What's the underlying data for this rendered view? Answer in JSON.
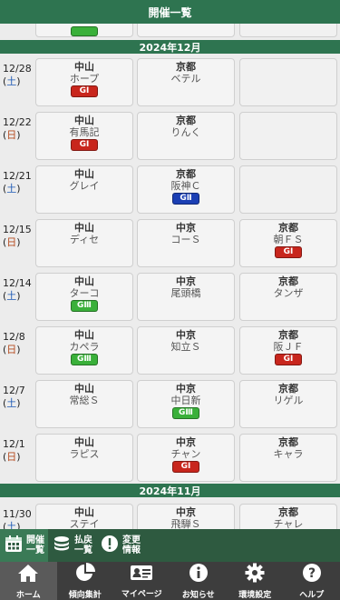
{
  "header": {
    "title": "開催一覧"
  },
  "colors": {
    "green_dark": "#2e7450",
    "g1": "#c8261d",
    "g2": "#1b3fb4",
    "g3": "#3ab03a"
  },
  "months": [
    {
      "label": "2024年12月"
    },
    {
      "label": "2024年11月"
    }
  ],
  "rows": [
    {
      "date": "12/28",
      "weekday": "土",
      "cells": [
        {
          "venue": "中山",
          "race": "ホープ",
          "grade": "GⅠ"
        },
        {
          "venue": "京都",
          "race": "ベテル",
          "grade": ""
        },
        null
      ]
    },
    {
      "date": "12/22",
      "weekday": "日",
      "cells": [
        {
          "venue": "中山",
          "race": "有馬記",
          "grade": "GⅠ"
        },
        {
          "venue": "京都",
          "race": "りんく",
          "grade": ""
        },
        null
      ]
    },
    {
      "date": "12/21",
      "weekday": "土",
      "cells": [
        {
          "venue": "中山",
          "race": "グレイ",
          "grade": ""
        },
        {
          "venue": "京都",
          "race": "阪神Ｃ",
          "grade": "GⅡ"
        },
        null
      ]
    },
    {
      "date": "12/15",
      "weekday": "日",
      "cells": [
        {
          "venue": "中山",
          "race": "ディセ",
          "grade": ""
        },
        {
          "venue": "中京",
          "race": "コーＳ",
          "grade": ""
        },
        {
          "venue": "京都",
          "race": "朝ＦＳ",
          "grade": "GⅠ"
        }
      ]
    },
    {
      "date": "12/14",
      "weekday": "土",
      "cells": [
        {
          "venue": "中山",
          "race": "ターコ",
          "grade": "GⅢ"
        },
        {
          "venue": "中京",
          "race": "尾頭橋",
          "grade": ""
        },
        {
          "venue": "京都",
          "race": "タンザ",
          "grade": ""
        }
      ]
    },
    {
      "date": "12/8",
      "weekday": "日",
      "cells": [
        {
          "venue": "中山",
          "race": "カペラ",
          "grade": "GⅢ"
        },
        {
          "venue": "中京",
          "race": "知立Ｓ",
          "grade": ""
        },
        {
          "venue": "京都",
          "race": "阪ＪＦ",
          "grade": "GⅠ"
        }
      ]
    },
    {
      "date": "12/7",
      "weekday": "土",
      "cells": [
        {
          "venue": "中山",
          "race": "常総Ｓ",
          "grade": ""
        },
        {
          "venue": "中京",
          "race": "中日新",
          "grade": "GⅢ"
        },
        {
          "venue": "京都",
          "race": "リゲル",
          "grade": ""
        }
      ]
    },
    {
      "date": "12/1",
      "weekday": "日",
      "cells": [
        {
          "venue": "中山",
          "race": "ラピス",
          "grade": ""
        },
        {
          "venue": "中京",
          "race": "チャン",
          "grade": "GⅠ"
        },
        {
          "venue": "京都",
          "race": "キャラ",
          "grade": ""
        }
      ]
    },
    {
      "date": "11/30",
      "weekday": "土",
      "cells": [
        {
          "venue": "中山",
          "race": "ステイ",
          "grade": ""
        },
        {
          "venue": "中京",
          "race": "飛騨Ｓ",
          "grade": ""
        },
        {
          "venue": "京都",
          "race": "チャレ",
          "grade": ""
        }
      ]
    }
  ],
  "subtabs": [
    {
      "icon": "calendar-icon",
      "label1": "開催",
      "label2": "一覧"
    },
    {
      "icon": "coins-icon",
      "label1": "払戻",
      "label2": "一覧"
    },
    {
      "icon": "alert-icon",
      "label1": "変更",
      "label2": "情報"
    }
  ],
  "nav": [
    {
      "icon": "home-icon",
      "label": "ホーム"
    },
    {
      "icon": "pie-chart-icon",
      "label": "傾向集計"
    },
    {
      "icon": "id-card-icon",
      "label": "マイページ"
    },
    {
      "icon": "info-icon",
      "label": "お知らせ"
    },
    {
      "icon": "gear-icon",
      "label": "環境設定"
    },
    {
      "icon": "help-icon",
      "label": "ヘルプ"
    }
  ]
}
